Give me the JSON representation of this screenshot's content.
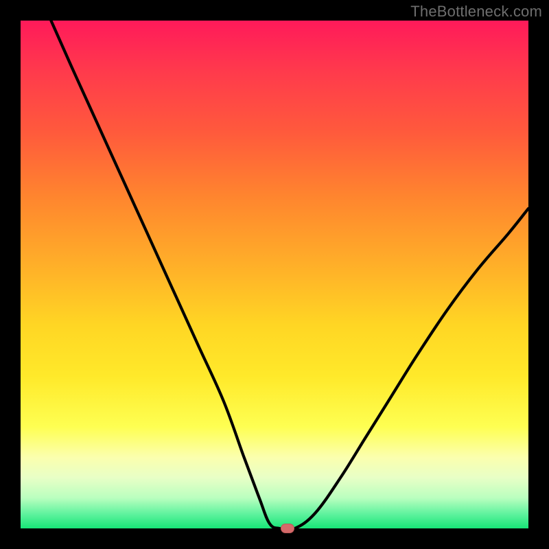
{
  "watermark": "TheBottleneck.com",
  "chart_data": {
    "type": "line",
    "title": "",
    "xlabel": "",
    "ylabel": "",
    "xlim": [
      0,
      100
    ],
    "ylim": [
      0,
      100
    ],
    "grid": false,
    "legend": false,
    "series": [
      {
        "name": "bottleneck-curve",
        "x": [
          6,
          10,
          15,
          20,
          25,
          30,
          35,
          40,
          44,
          47,
          49,
          51,
          54,
          58,
          63,
          68,
          73,
          78,
          84,
          90,
          96,
          100
        ],
        "y": [
          100,
          91,
          80,
          69,
          58,
          47,
          36,
          25,
          14,
          6,
          1,
          0,
          0,
          3,
          10,
          18,
          26,
          34,
          43,
          51,
          58,
          63
        ]
      }
    ],
    "marker": {
      "x": 52.5,
      "y": 0
    },
    "background_gradient": {
      "top": "#ff1a5a",
      "mid": "#ffd624",
      "bottom": "#17e677"
    },
    "frame_color": "#000000"
  }
}
